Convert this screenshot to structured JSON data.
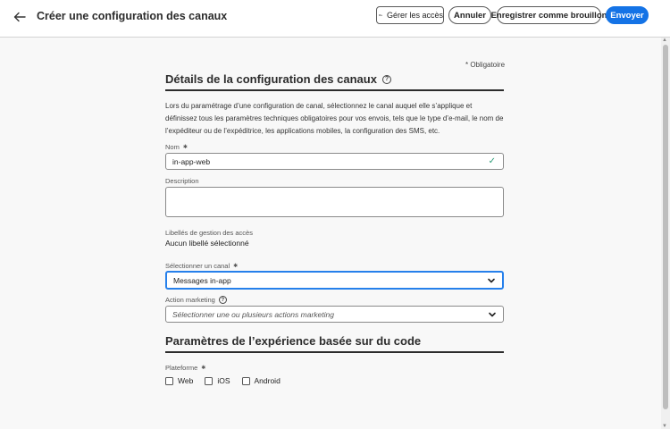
{
  "header": {
    "title": "Créer une configuration des canaux",
    "access_label": "Gérer les accès",
    "cancel_label": "Annuler",
    "draft_label": "Enregistrer comme brouillon",
    "send_label": "Envoyer"
  },
  "form": {
    "required_note": "* Obligatoire",
    "section1_title": "Détails de la configuration des canaux",
    "intro": "Lors du paramétrage d’une configuration de canal, sélectionnez le canal auquel elle s’applique et définissez tous les paramètres techniques obligatoires pour vos envois, tels que le type d’e-mail, le nom de l’expéditeur ou de l’expéditrice, les applications mobiles, la configuration des SMS, etc.",
    "name_label": "Nom",
    "name_value": "in-app-web",
    "description_label": "Description",
    "description_value": "",
    "access_labels_label": "Libellés de gestion des accès",
    "access_labels_value": "Aucun libellé sélectionné",
    "channel_label": "Sélectionner un canal",
    "channel_value": "Messages in-app",
    "marketing_label": "Action marketing",
    "marketing_placeholder": "Sélectionner une ou plusieurs actions marketing",
    "section2_title": "Paramètres de l’expérience basée sur du code",
    "platform_label": "Plateforme",
    "platforms": [
      "Web",
      "iOS",
      "Android"
    ]
  },
  "colors": {
    "accent": "#1473e6",
    "focus": "#2680eb",
    "valid": "#2d9d78"
  }
}
